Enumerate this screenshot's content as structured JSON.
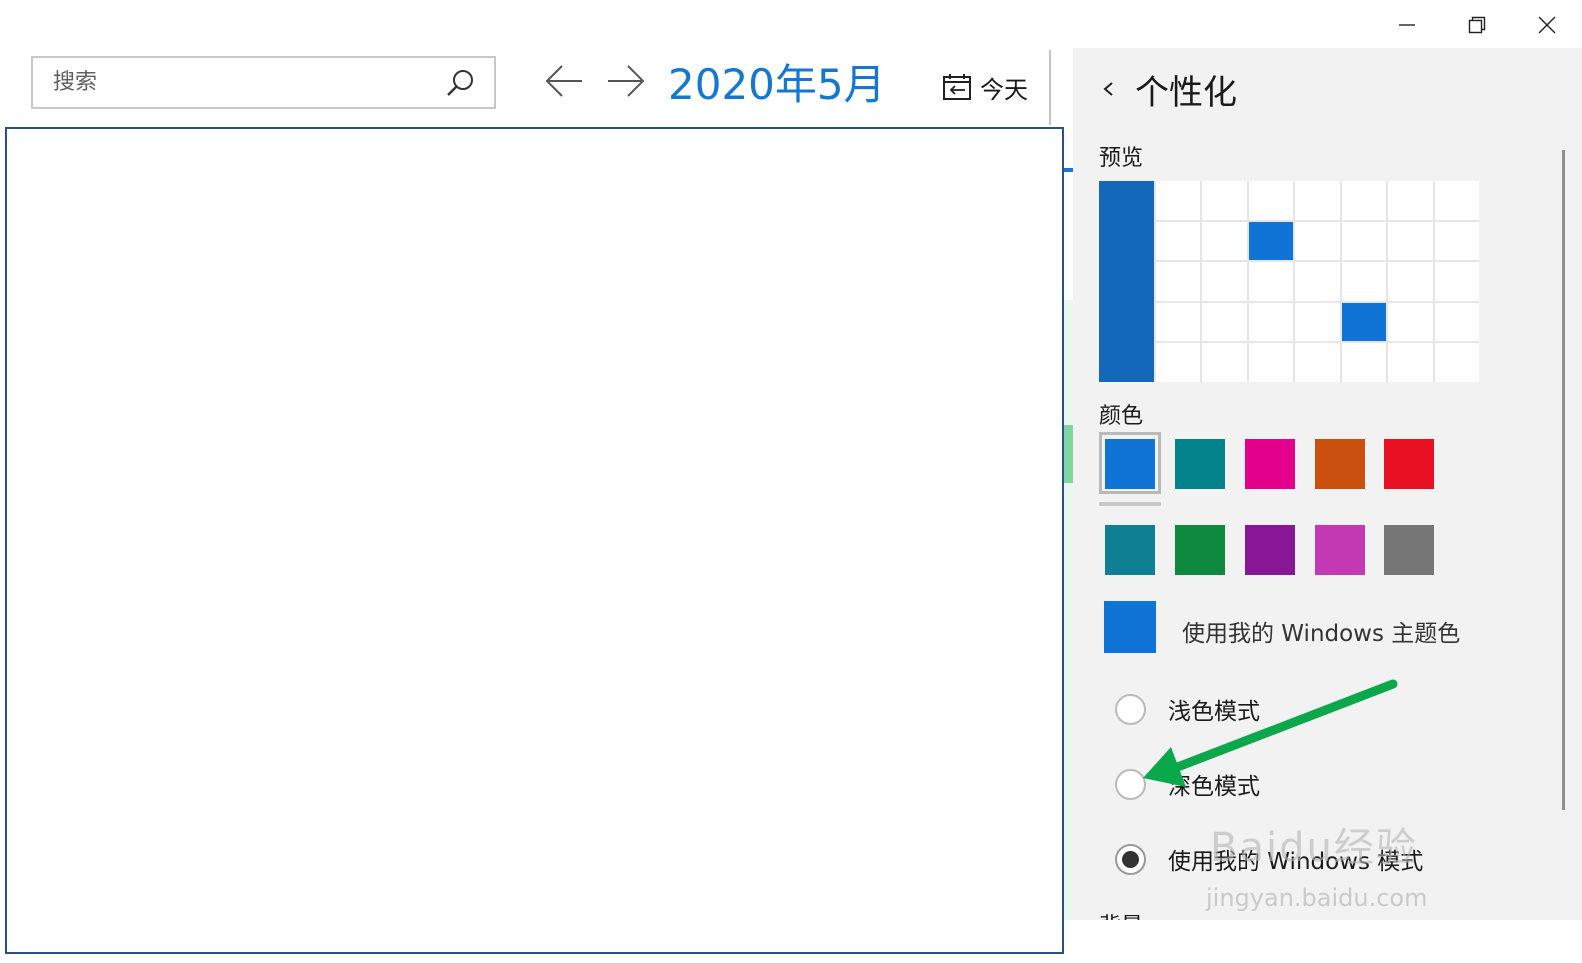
{
  "window_controls": {
    "minimize": "minimize-icon",
    "restore": "restore-icon",
    "close": "close-icon"
  },
  "header": {
    "search_placeholder": "搜索",
    "month_title": "2020年5月",
    "today_label": "今天"
  },
  "panel": {
    "title": "个性化",
    "preview_label": "预览",
    "colors_label": "颜色",
    "swatches_row1": [
      "#0f74d6",
      "#02838b",
      "#e3008c",
      "#ca5010",
      "#e81123"
    ],
    "swatches_row2": [
      "#0f7f93",
      "#0e8a3f",
      "#881798",
      "#c239b3",
      "#767676"
    ],
    "selected_swatch": "#0f74d6",
    "theme_color_label": "使用我的 Windows 主题色",
    "radios": [
      {
        "label": "浅色模式",
        "checked": false
      },
      {
        "label": "深色模式",
        "checked": false
      },
      {
        "label": "使用我的 Windows 模式",
        "checked": true
      }
    ],
    "next_section_label": "背景"
  },
  "annotation": {
    "arrow_color": "#0ba84b"
  },
  "watermark": {
    "main": "Baidu经验",
    "sub": "jingyan.baidu.com"
  }
}
